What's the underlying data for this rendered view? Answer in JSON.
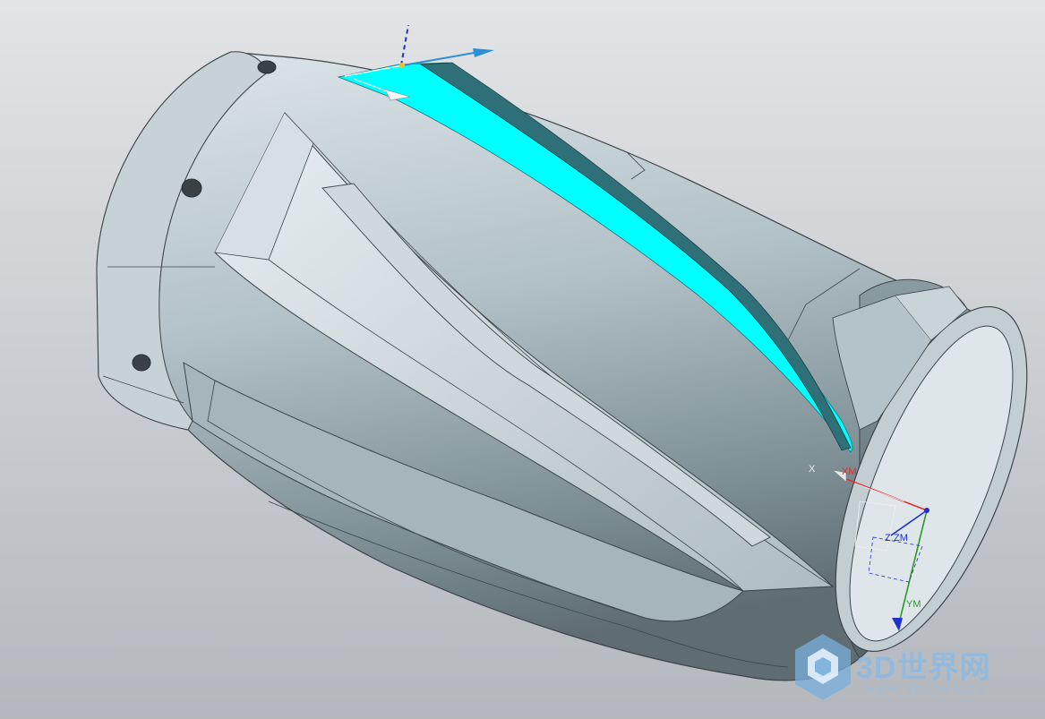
{
  "viewport": {
    "background_top": "#e2e4e6",
    "background_bottom": "#b4b8bd"
  },
  "model": {
    "body_color": "#9fb0b8",
    "highlight_face_color": "#00ffff",
    "edge_color": "#3c4448"
  },
  "csys": {
    "x_label": "X",
    "xm_label": "XM",
    "z_label": "Z",
    "zm_label": "ZM",
    "ym_label": "YM",
    "x_color": "#e03030",
    "y_color": "#2a9a2a",
    "z_color": "#2030d0"
  },
  "watermark": {
    "title": "3D世界网",
    "url": "WWW.3DSJW.COM",
    "logo_icon": "cube-logo-icon"
  }
}
